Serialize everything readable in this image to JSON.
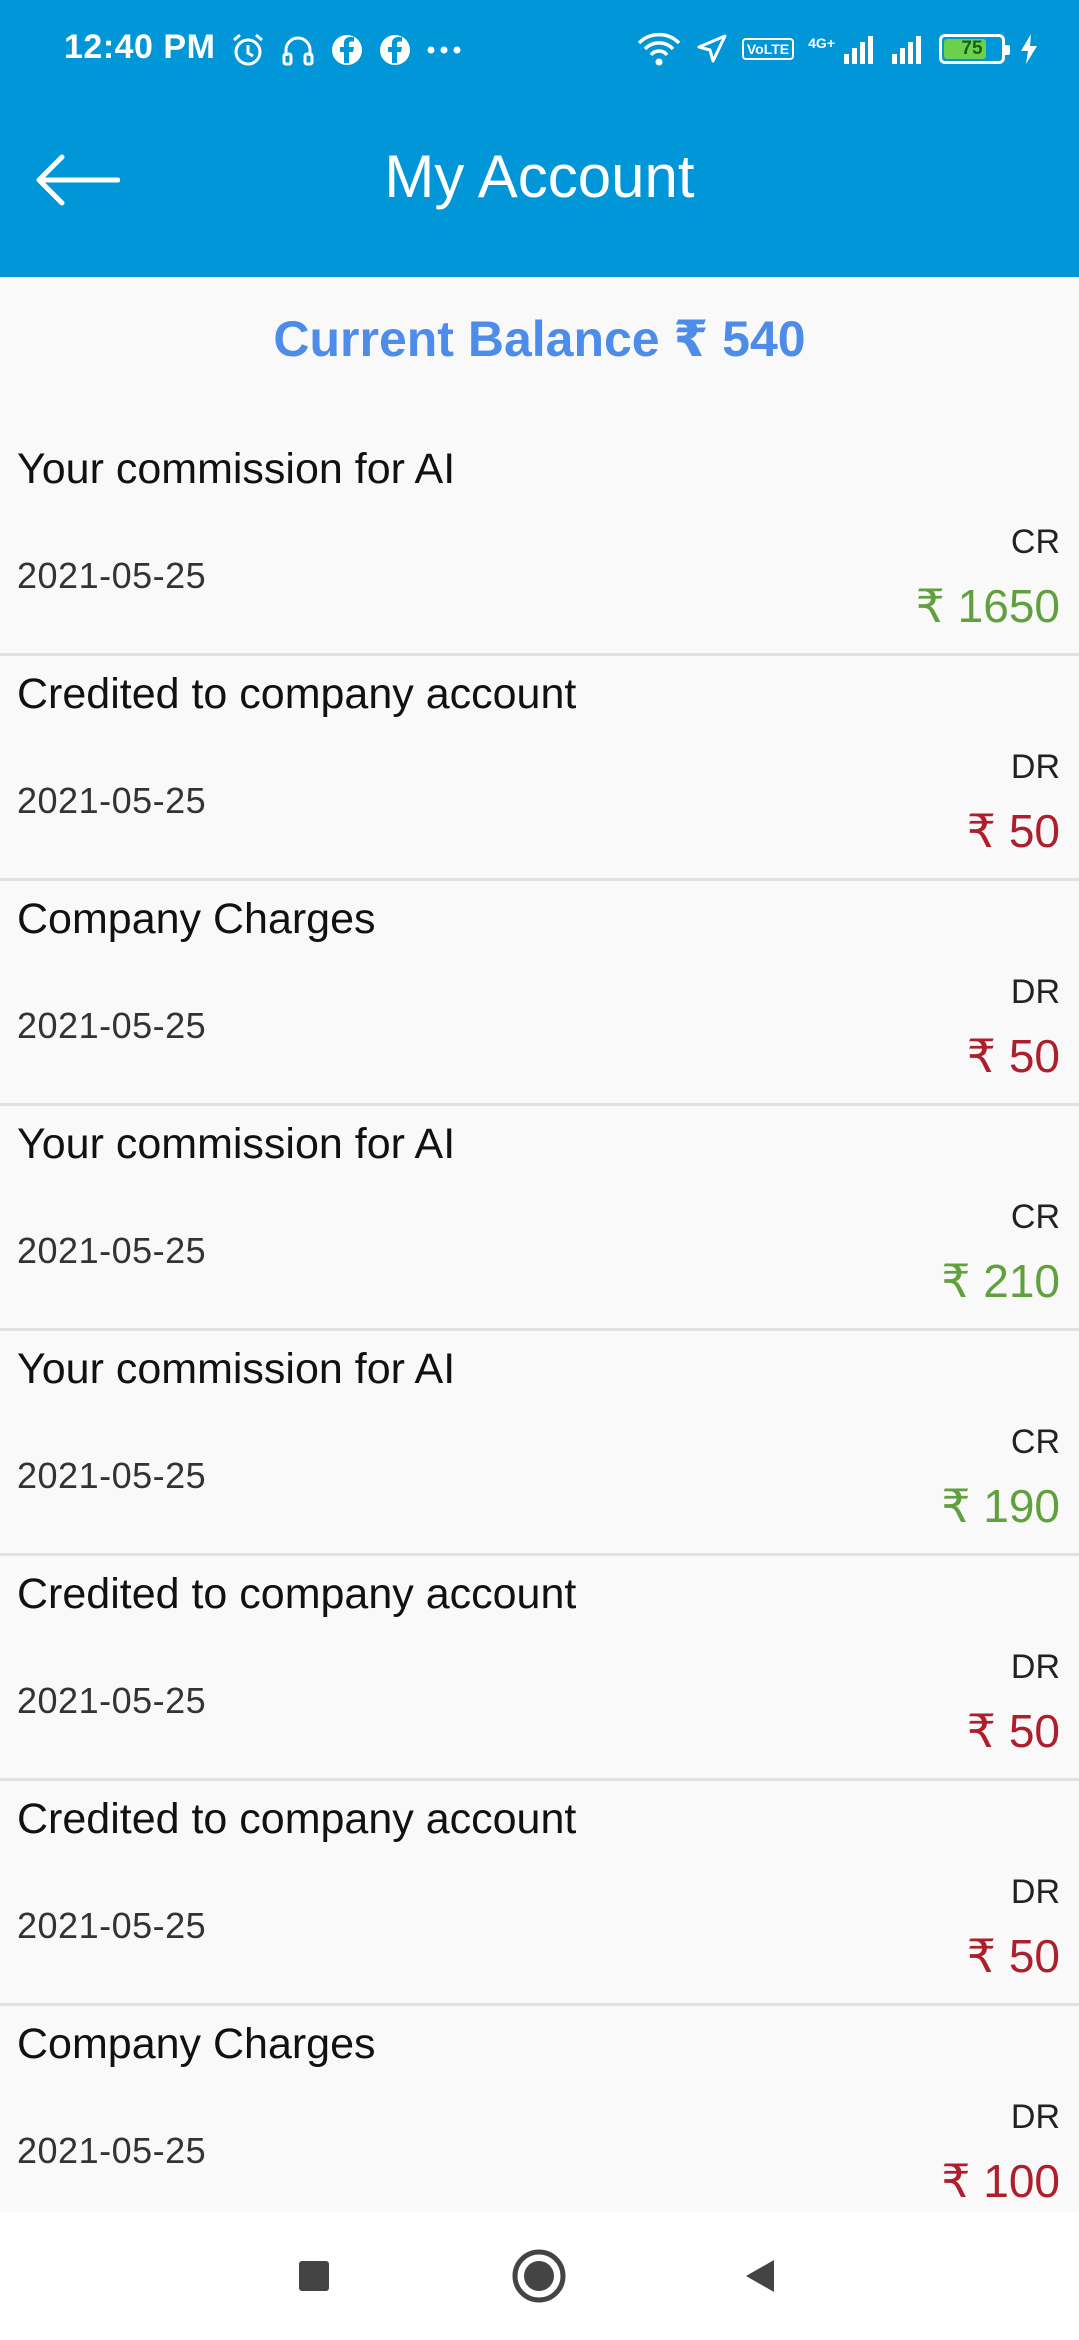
{
  "status_bar": {
    "time": "12:40 PM",
    "left_icons": [
      "alarm-icon",
      "headset-icon",
      "facebook-icon",
      "facebook-icon",
      "more-notifications-icon"
    ],
    "right_icons": [
      "wifi-icon",
      "location-arrow-icon",
      "volte-icon",
      "signal-icon",
      "signal-icon",
      "battery-icon",
      "charging-icon"
    ],
    "volte_label_line1": "Vo",
    "volte_label_line2": "LTE",
    "network_label": "4G+",
    "battery_level": "75"
  },
  "appbar": {
    "title": "My Account",
    "back_icon": "arrow-left-icon",
    "background": "#0196d8"
  },
  "balance": {
    "text": "Current Balance ₹ 540",
    "color": "#4e8cea"
  },
  "transactions": [
    {
      "description": "Your commission for AI",
      "date": "2021-05-25",
      "type": "CR",
      "amount": "₹ 1650"
    },
    {
      "description": "Credited to company account",
      "date": "2021-05-25",
      "type": "DR",
      "amount": "₹ 50"
    },
    {
      "description": "Company Charges",
      "date": "2021-05-25",
      "type": "DR",
      "amount": "₹ 50"
    },
    {
      "description": "Your commission for AI",
      "date": "2021-05-25",
      "type": "CR",
      "amount": "₹ 210"
    },
    {
      "description": "Your commission for AI",
      "date": "2021-05-25",
      "type": "CR",
      "amount": "₹ 190"
    },
    {
      "description": "Credited to company account",
      "date": "2021-05-25",
      "type": "DR",
      "amount": "₹ 50"
    },
    {
      "description": "Credited to company account",
      "date": "2021-05-25",
      "type": "DR",
      "amount": "₹ 50"
    },
    {
      "description": "Company Charges",
      "date": "2021-05-25",
      "type": "DR",
      "amount": "₹ 100"
    }
  ],
  "colors": {
    "credit": "#62a03d",
    "debit": "#ad1f2c"
  },
  "navbar": {
    "buttons": [
      "recents-square-icon",
      "home-circle-icon",
      "back-triangle-icon"
    ]
  }
}
